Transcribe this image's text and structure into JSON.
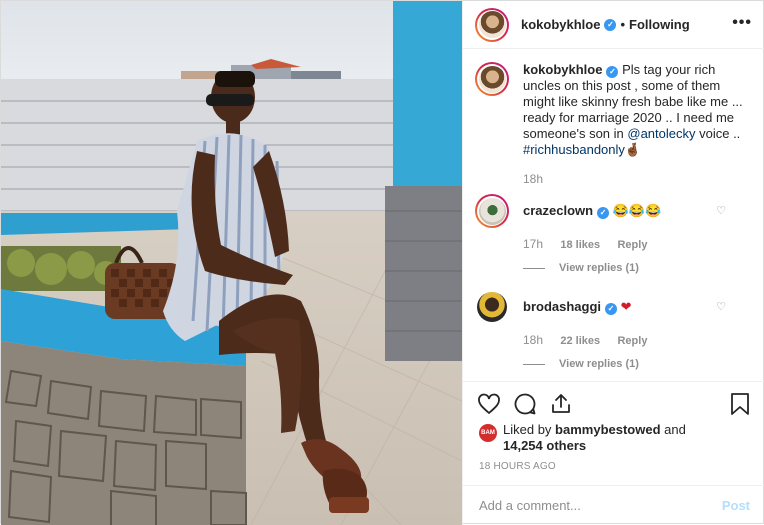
{
  "header": {
    "username": "kokobykhloe",
    "separator": "•",
    "follow_status": "Following",
    "more_icon": "more-options-icon"
  },
  "caption": {
    "username": "kokobykhloe",
    "text_before_mention": "Pls tag your rich uncles on this post , some of them might like skinny fresh babe like me ... ready for marriage 2020 .. I need me someone's son in ",
    "mention": "@antolecky",
    "text_after_mention": " voice .. ",
    "hashtag": "#richhusbandonly",
    "emoji": "🤞🏾",
    "time": "18h"
  },
  "comments": [
    {
      "username": "crazeclown",
      "text": "😂😂😂",
      "time": "17h",
      "likes": "18 likes",
      "reply": "Reply",
      "view_replies": "View replies (1)"
    },
    {
      "username": "brodashaggi",
      "text": "❤",
      "time": "18h",
      "likes": "22 likes",
      "reply": "Reply",
      "view_replies": "View replies (1)"
    }
  ],
  "likes": {
    "badge": "BAM",
    "prefix": "Liked by ",
    "liker": "bammybestowed",
    "middle": " and",
    "count": "14,254 others"
  },
  "timestamp": "18 HOURS AGO",
  "add_comment": {
    "placeholder": "Add a comment...",
    "post_label": "Post"
  },
  "colors": {
    "verified": "#3897f0",
    "link": "#003569",
    "muted": "#8e8e8e",
    "post_button": "#b2dffc"
  }
}
